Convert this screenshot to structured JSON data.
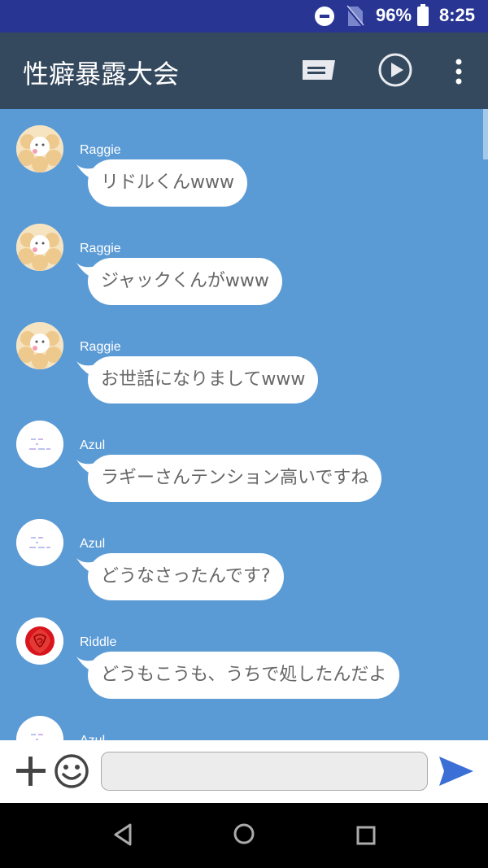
{
  "status": {
    "battery_percent": "96%",
    "time": "8:25",
    "icons": [
      "do-not-disturb-icon",
      "no-sim-icon",
      "battery-icon"
    ]
  },
  "header": {
    "title": "性癖暴露大会",
    "icons": [
      "note-icon",
      "play-icon",
      "more-vert-icon"
    ]
  },
  "messages": [
    {
      "sender": "Raggie",
      "text": "リドルくんwww",
      "avatar": "raggie-avatar"
    },
    {
      "sender": "Raggie",
      "text": "ジャックくんがwww",
      "avatar": "raggie-avatar"
    },
    {
      "sender": "Raggie",
      "text": "お世話になりましてwww",
      "avatar": "raggie-avatar"
    },
    {
      "sender": "Azul",
      "text": "ラギーさんテンション高いですね",
      "avatar": "azul-avatar"
    },
    {
      "sender": "Azul",
      "text": "どうなさったんです?",
      "avatar": "azul-avatar"
    },
    {
      "sender": "Riddle",
      "text": "どうもこうも、うちで処したんだよ",
      "avatar": "riddle-avatar"
    },
    {
      "sender": "Azul",
      "text": "",
      "avatar": "azul-avatar"
    }
  ],
  "composer": {
    "value": "",
    "placeholder": ""
  },
  "colors": {
    "status_bar": "#283593",
    "app_bar": "#34495e",
    "chat_bg": "#5b9bd5",
    "send_accent": "#3b6fd6"
  }
}
